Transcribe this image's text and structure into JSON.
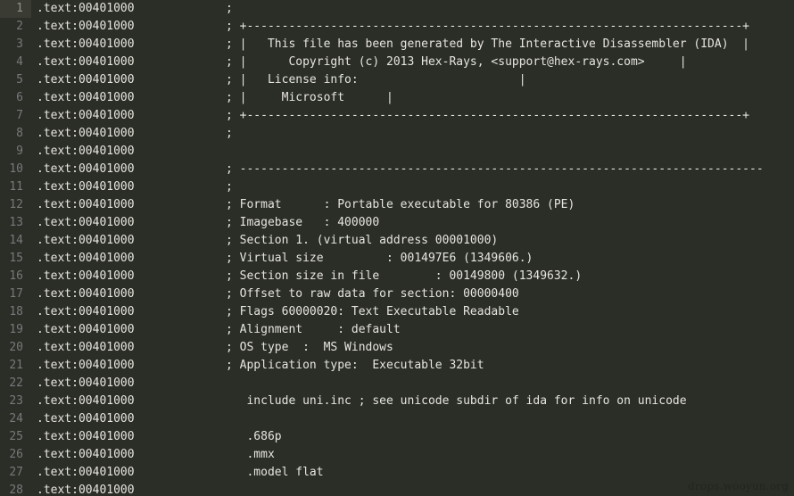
{
  "editor": {
    "title": "IDA Disassembly Listing",
    "background_color": "#2b2d27",
    "text_color": "#e6e6de",
    "gutter_color": "#767a7a",
    "active_line_background": "#3a3b33",
    "active_line": 1,
    "total_lines": 28,
    "first_line_number": 1,
    "last_line_number": 28
  },
  "watermark": {
    "text": "drops.wooyun.org"
  },
  "lines": [
    {
      "num": "1",
      "addr": ".text:00401000",
      "text": ";"
    },
    {
      "num": "2",
      "addr": ".text:00401000",
      "text": "; +-----------------------------------------------------------------------+"
    },
    {
      "num": "3",
      "addr": ".text:00401000",
      "text": "; |   This file has been generated by The Interactive Disassembler (IDA)  |"
    },
    {
      "num": "4",
      "addr": ".text:00401000",
      "text": "; |      Copyright (c) 2013 Hex-Rays, <support@hex-rays.com>     |"
    },
    {
      "num": "5",
      "addr": ".text:00401000",
      "text": "; |   License info:                       |"
    },
    {
      "num": "6",
      "addr": ".text:00401000",
      "text": "; |     Microsoft      |"
    },
    {
      "num": "7",
      "addr": ".text:00401000",
      "text": "; +-----------------------------------------------------------------------+"
    },
    {
      "num": "8",
      "addr": ".text:00401000",
      "text": ";"
    },
    {
      "num": "9",
      "addr": ".text:00401000",
      "text": ""
    },
    {
      "num": "10",
      "addr": ".text:00401000",
      "text": "; ---------------------------------------------------------------------------"
    },
    {
      "num": "11",
      "addr": ".text:00401000",
      "text": ";"
    },
    {
      "num": "12",
      "addr": ".text:00401000",
      "text": "; Format      : Portable executable for 80386 (PE)"
    },
    {
      "num": "13",
      "addr": ".text:00401000",
      "text": "; Imagebase   : 400000"
    },
    {
      "num": "14",
      "addr": ".text:00401000",
      "text": "; Section 1. (virtual address 00001000)"
    },
    {
      "num": "15",
      "addr": ".text:00401000",
      "text": "; Virtual size         : 001497E6 (1349606.)"
    },
    {
      "num": "16",
      "addr": ".text:00401000",
      "text": "; Section size in file        : 00149800 (1349632.)"
    },
    {
      "num": "17",
      "addr": ".text:00401000",
      "text": "; Offset to raw data for section: 00000400"
    },
    {
      "num": "18",
      "addr": ".text:00401000",
      "text": "; Flags 60000020: Text Executable Readable"
    },
    {
      "num": "19",
      "addr": ".text:00401000",
      "text": "; Alignment     : default"
    },
    {
      "num": "20",
      "addr": ".text:00401000",
      "text": "; OS type  :  MS Windows"
    },
    {
      "num": "21",
      "addr": ".text:00401000",
      "text": "; Application type:  Executable 32bit"
    },
    {
      "num": "22",
      "addr": ".text:00401000",
      "text": ""
    },
    {
      "num": "23",
      "addr": ".text:00401000",
      "text": "   include uni.inc ; see unicode subdir of ida for info on unicode"
    },
    {
      "num": "24",
      "addr": ".text:00401000",
      "text": ""
    },
    {
      "num": "25",
      "addr": ".text:00401000",
      "text": "   .686p"
    },
    {
      "num": "26",
      "addr": ".text:00401000",
      "text": "   .mmx"
    },
    {
      "num": "27",
      "addr": ".text:00401000",
      "text": "   .model flat"
    },
    {
      "num": "28",
      "addr": ".text:00401000",
      "text": ""
    }
  ]
}
